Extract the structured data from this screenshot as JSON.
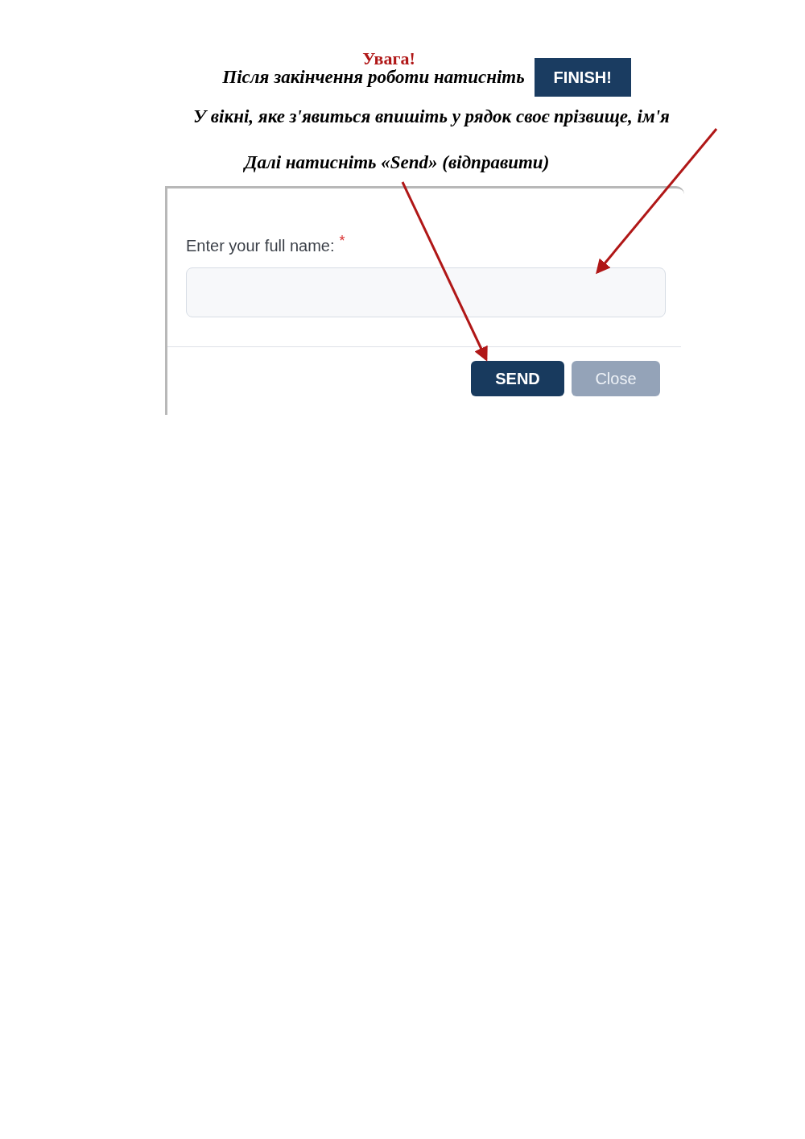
{
  "notice": {
    "heading": "Увага!",
    "line_1": "Після закінчення роботи натисніть",
    "finish_button": "FINISH!",
    "line_2": "У вікні, яке з'явиться впишіть у рядок своє прізвище, ім'я",
    "line_3": "Далі натисніть «Send» (відправити)"
  },
  "dialog": {
    "field_label": "Enter your full name:",
    "required_mark": "*",
    "buttons": [
      {
        "label": "SEND",
        "kind": "primary",
        "disabled": false
      },
      {
        "label": "Close",
        "kind": "secondary",
        "disabled": true
      }
    ]
  }
}
